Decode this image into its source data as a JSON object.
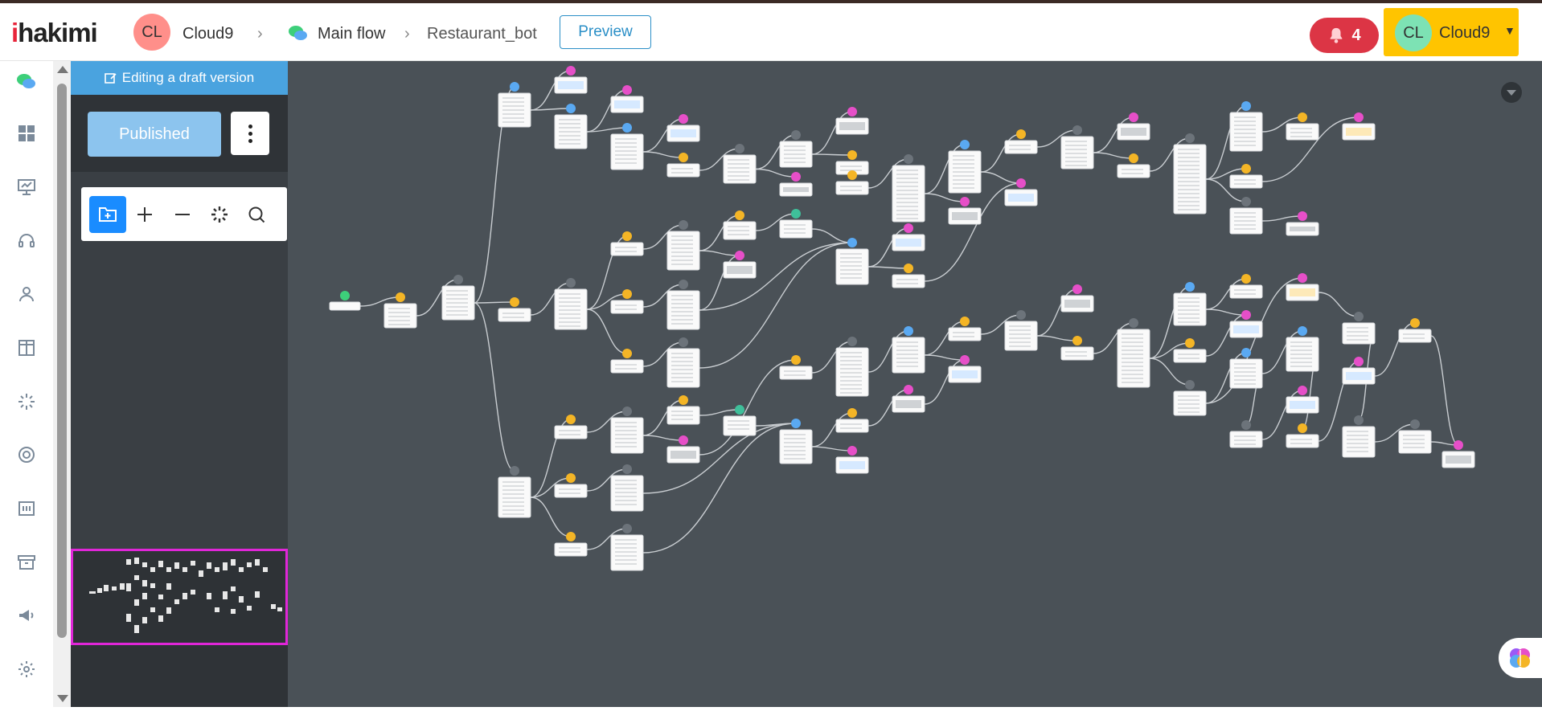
{
  "header": {
    "logo": "hakimi",
    "workspace": {
      "initials": "CL",
      "name": "Cloud9"
    },
    "breadcrumb": {
      "flow": "Main flow",
      "bot": "Restaurant_bot"
    },
    "preview_label": "Preview",
    "notifications": {
      "count": "4"
    },
    "account": {
      "initials": "CL",
      "name": "Cloud9"
    }
  },
  "sidebar": {
    "icons": [
      "chat-flow-icon",
      "dashboard-icon",
      "presentation-icon",
      "headset-icon",
      "user-icon",
      "columns-icon",
      "loader-icon",
      "lifebuoy-icon",
      "form-icon",
      "archive-icon",
      "megaphone-icon",
      "settings-icon"
    ]
  },
  "panel": {
    "draft_label": "Editing a draft version",
    "published_label": "Published",
    "toolbar": [
      "add-folder-icon",
      "zoom-in-icon",
      "zoom-out-icon",
      "auto-layout-icon",
      "search-icon"
    ]
  },
  "colors": {
    "canvas": "#4a5157",
    "node_blue": "#5aa9f2",
    "node_pink": "#e64fc8",
    "node_yellow": "#f4b526",
    "node_gray": "#6c737a",
    "node_green": "#3dd07a",
    "node_teal": "#3fbf9a",
    "accent": "#1a8cff",
    "notification": "#dc3545",
    "account": "#ffc400"
  }
}
